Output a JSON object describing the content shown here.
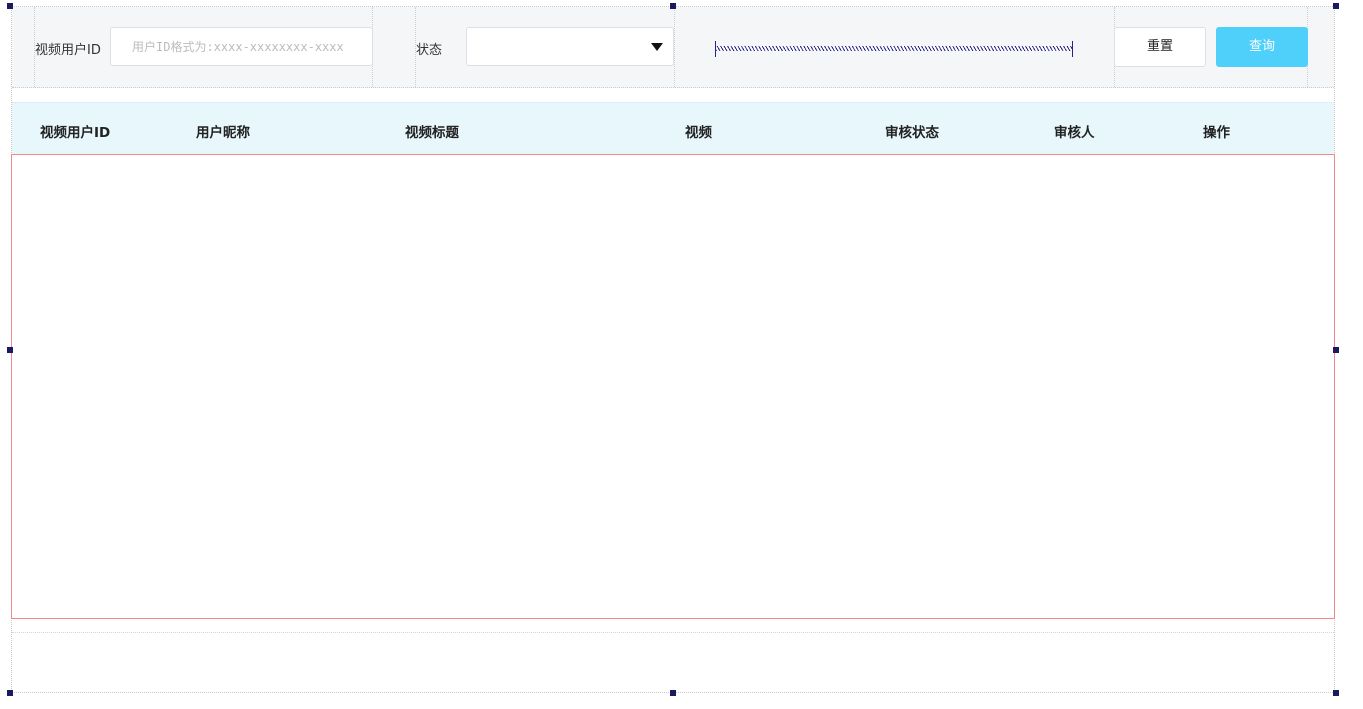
{
  "search": {
    "user_id_label": "视频用户ID",
    "user_id_placeholder": "用户ID格式为:xxxx-xxxxxxxx-xxxx",
    "user_id_value": "",
    "status_label": "状态",
    "status_value": "",
    "reset_label": "重置",
    "query_label": "查询"
  },
  "table": {
    "columns": [
      "视频用户ID",
      "用户昵称",
      "视频标题",
      "视频",
      "审核状态",
      "审核人",
      "操作"
    ],
    "rows": []
  },
  "colors": {
    "query_button": "#4fd0fb",
    "header_background": "#e8f7fc",
    "selection_border": "#f08a8a",
    "handle": "#1a1a5e"
  }
}
